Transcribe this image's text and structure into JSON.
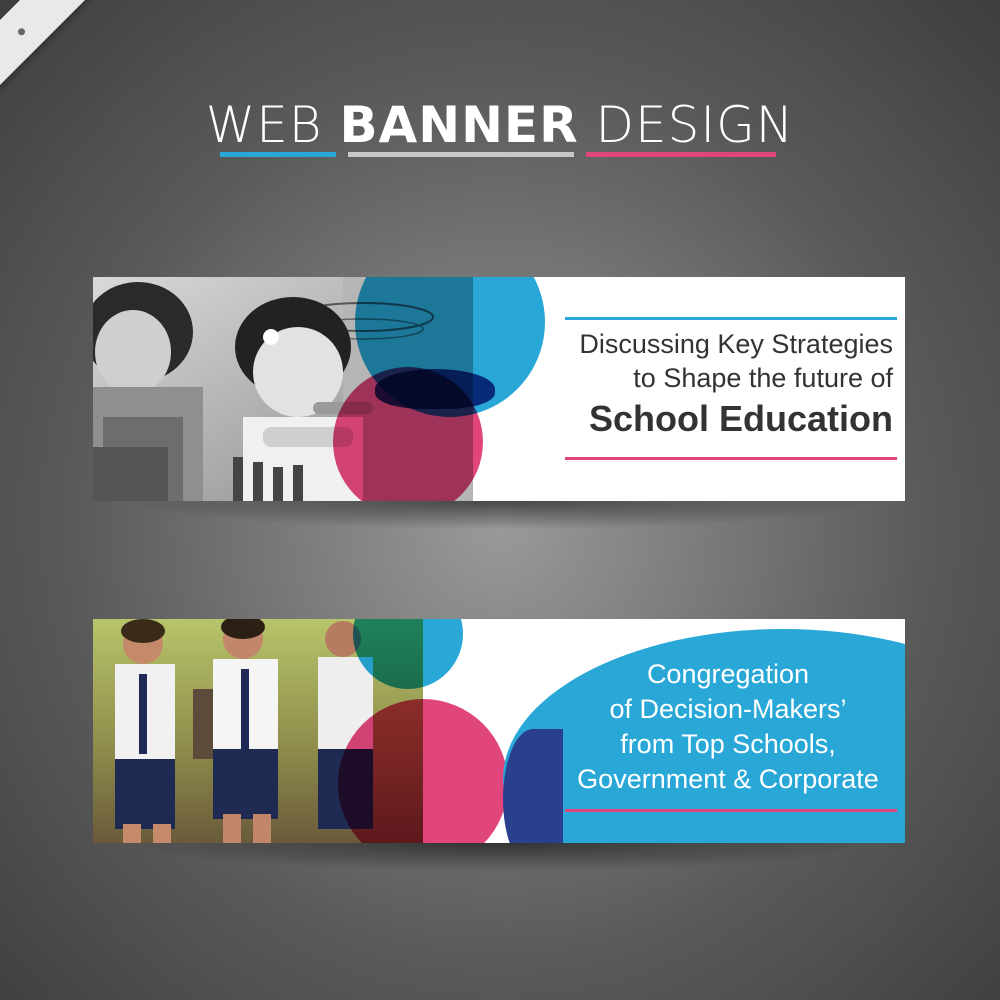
{
  "header": {
    "title_light_1": "WEB ",
    "title_bold": "BANNER",
    "title_light_2": " DESIGN",
    "underline_colors": [
      "#29a8d8",
      "#c8c8c8",
      "#e0467c"
    ]
  },
  "banner1": {
    "line1": "Discussing Key Strategies",
    "line2": "to Shape the future of",
    "line3": "School Education",
    "top_rule_color": "#29a8d8",
    "bottom_rule_color": "#e0467c",
    "photo": "black-and-white photo of young girls playing with wooden toys"
  },
  "banner2": {
    "line1": "Congregation",
    "line2": "of Decision-Makers’",
    "line3": "from Top Schools,",
    "line4": "Government & Corporate",
    "bubble_color": "#29a8d8",
    "rule_color": "#e0467c",
    "photo": "color photo of school children in uniforms walking outdoors"
  },
  "colors": {
    "blue": "#29a8d8",
    "pink": "#e0467c",
    "navy": "#2b3f8f"
  }
}
